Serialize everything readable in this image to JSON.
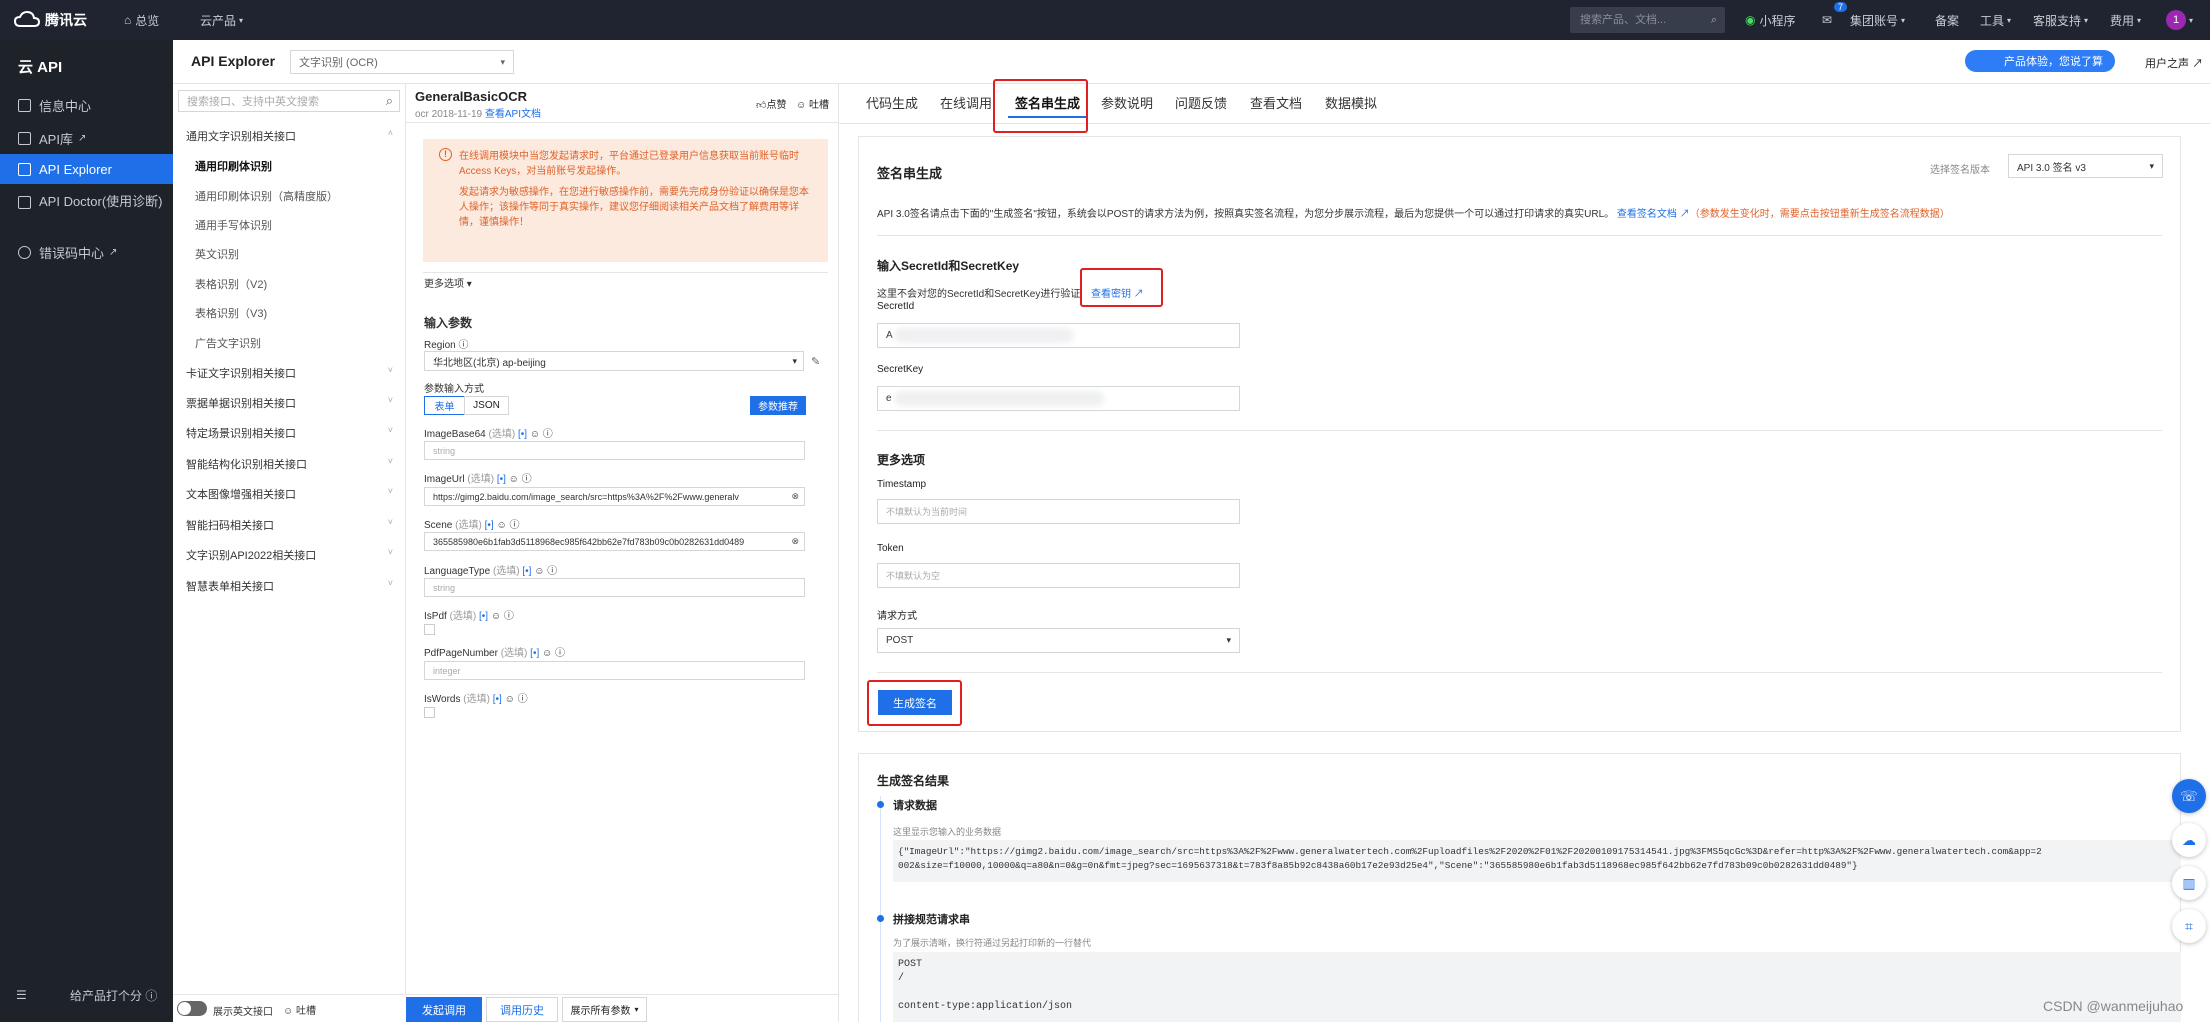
{
  "topbar": {
    "logo": "腾讯云",
    "overview": "总览",
    "products": "云产品",
    "search_placeholder": "搜索产品、文档...",
    "mini_program": "小程序",
    "msg_badge": "7",
    "group_account": "集团账号",
    "record": "备案",
    "tools": "工具",
    "support": "客服支持",
    "billing": "费用",
    "avatar": "1"
  },
  "sidebar": {
    "title": "云 API",
    "items": [
      {
        "label": "信息中心"
      },
      {
        "label": "API库"
      },
      {
        "label": "API Explorer"
      },
      {
        "label": "API Doctor(使用诊断)"
      },
      {
        "label": "错误码中心"
      }
    ],
    "footer": "给产品打个分"
  },
  "header": {
    "title": "API Explorer",
    "product_select": "文字识别 (OCR)",
    "banner": "产品体验，您说了算",
    "user": "用户之声"
  },
  "tree": {
    "search_placeholder": "搜索接口、支持中英文搜索",
    "groups": [
      "通用文字识别相关接口",
      "通用印刷体识别",
      "通用印刷体识别（高精度版）",
      "通用手写体识别",
      "英文识别",
      "表格识别（V2)",
      "表格识别（V3)",
      "广告文字识别",
      "卡证文字识别相关接口",
      "票据单据识别相关接口",
      "特定场景识别相关接口",
      "智能结构化识别相关接口",
      "文本图像增强相关接口",
      "智能扫码相关接口",
      "文字识别API2022相关接口",
      "智慧表单相关接口"
    ],
    "footer_toggle": "展示英文接口",
    "footer_feedback": "吐槽"
  },
  "params": {
    "api_name": "GeneralBasicOCR",
    "api_meta": "ocr 2018-11-19",
    "api_doc": "查看API文档",
    "like": "点赞",
    "complain": "吐槽",
    "warn1": "在线调用模块中当您发起请求时，平台通过已登录用户信息获取当前账号临时Access Keys，对当前账号发起操作。",
    "warn2": "发起请求为敏感操作，在您进行敏感操作前，需要先完成身份验证以确保是您本人操作；该操作等同于真实操作，建议您仔细阅读相关产品文档了解费用等详情，谨慎操作！",
    "more": "更多选项",
    "input_title": "输入参数",
    "region_label": "Region",
    "region_value": "华北地区(北京) ap-beijing",
    "mode_label": "参数输入方式",
    "mode_form": "表单",
    "mode_json": "JSON",
    "recommend": "参数推荐",
    "fields": [
      {
        "name": "ImageBase64",
        "opt": "(选填)",
        "value": "",
        "ph": "string"
      },
      {
        "name": "ImageUrl",
        "opt": "(选填)",
        "value": "https://gimg2.baidu.com/image_search/src=https%3A%2F%2Fwww.generalv",
        "ph": ""
      },
      {
        "name": "Scene",
        "opt": "(选填)",
        "value": "365585980e6b1fab3d5118968ec985f642bb62e7fd783b09c0b0282631dd0489",
        "ph": ""
      },
      {
        "name": "LanguageType",
        "opt": "(选填)",
        "value": "",
        "ph": "string"
      },
      {
        "name": "IsPdf",
        "opt": "(选填)",
        "value": "",
        "ph": ""
      },
      {
        "name": "PdfPageNumber",
        "opt": "(选填)",
        "value": "",
        "ph": "integer"
      },
      {
        "name": "IsWords",
        "opt": "(选填)",
        "value": "",
        "ph": ""
      }
    ],
    "send": "发起调用",
    "history": "调用历史",
    "show_all": "展示所有参数"
  },
  "tabs": [
    "代码生成",
    "在线调用",
    "签名串生成",
    "参数说明",
    "问题反馈",
    "查看文档",
    "数据模拟"
  ],
  "sign": {
    "title": "签名串生成",
    "version_label": "选择签名版本",
    "version_value": "API 3.0 签名 v3",
    "desc": "API 3.0签名请点击下面的\"生成签名\"按钮，系统会以POST的请求方法为例，按照真实签名流程，为您分步展示流程，最后为您提供一个可以通过打印请求的真实URL。",
    "desc_link": "查看签名文档",
    "desc_warn": "（参数发生变化时，需要点击按钮重新生成签名流程数据）",
    "secret_title": "输入SecretId和SecretKey",
    "secret_note": "这里不会对您的SecretId和SecretKey进行验证",
    "view_key": "查看密钥",
    "secret_id_label": "SecretId",
    "secret_id_value": "A",
    "secret_key_label": "SecretKey",
    "secret_key_value": "e",
    "more_title": "更多选项",
    "timestamp_label": "Timestamp",
    "timestamp_ph": "不填默认为当前时间",
    "token_label": "Token",
    "token_ph": "不填默认为空",
    "method_label": "请求方式",
    "method_value": "POST",
    "generate": "生成签名",
    "result_title": "生成签名结果",
    "req_title": "请求数据",
    "req_note": "这里显示您输入的业务数据",
    "req_line1": "{\"ImageUrl\":\"https://gimg2.baidu.com/image_search/src=https%3A%2F%2Fwww.generalwatertech.com%2Fuploadfiles%2F2020%2F01%2F20200109175314541.jpg%3FMS5qcGc%3D&refer=http%3A%2F%2Fwww.generalwatertech.com&app=2",
    "req_line2": "002&size=f10000,10000&q=a80&n=0&g=0n&fmt=jpeg?sec=1695637318&t=783f8a85b92c8438a60b17e2e93d25e4\",\"Scene\":\"365585980e6b1fab3d5118968ec985f642bb62e7fd783b09c0b0282631dd0489\"}",
    "canon_title": "拼接规范请求串",
    "canon_note": "为了展示清晰，换行符通过另起打印新的一行替代",
    "canon_lines": [
      "POST",
      "/",
      "",
      "content-type:application/json"
    ]
  },
  "watermark": "CSDN @wanmeijuhao"
}
